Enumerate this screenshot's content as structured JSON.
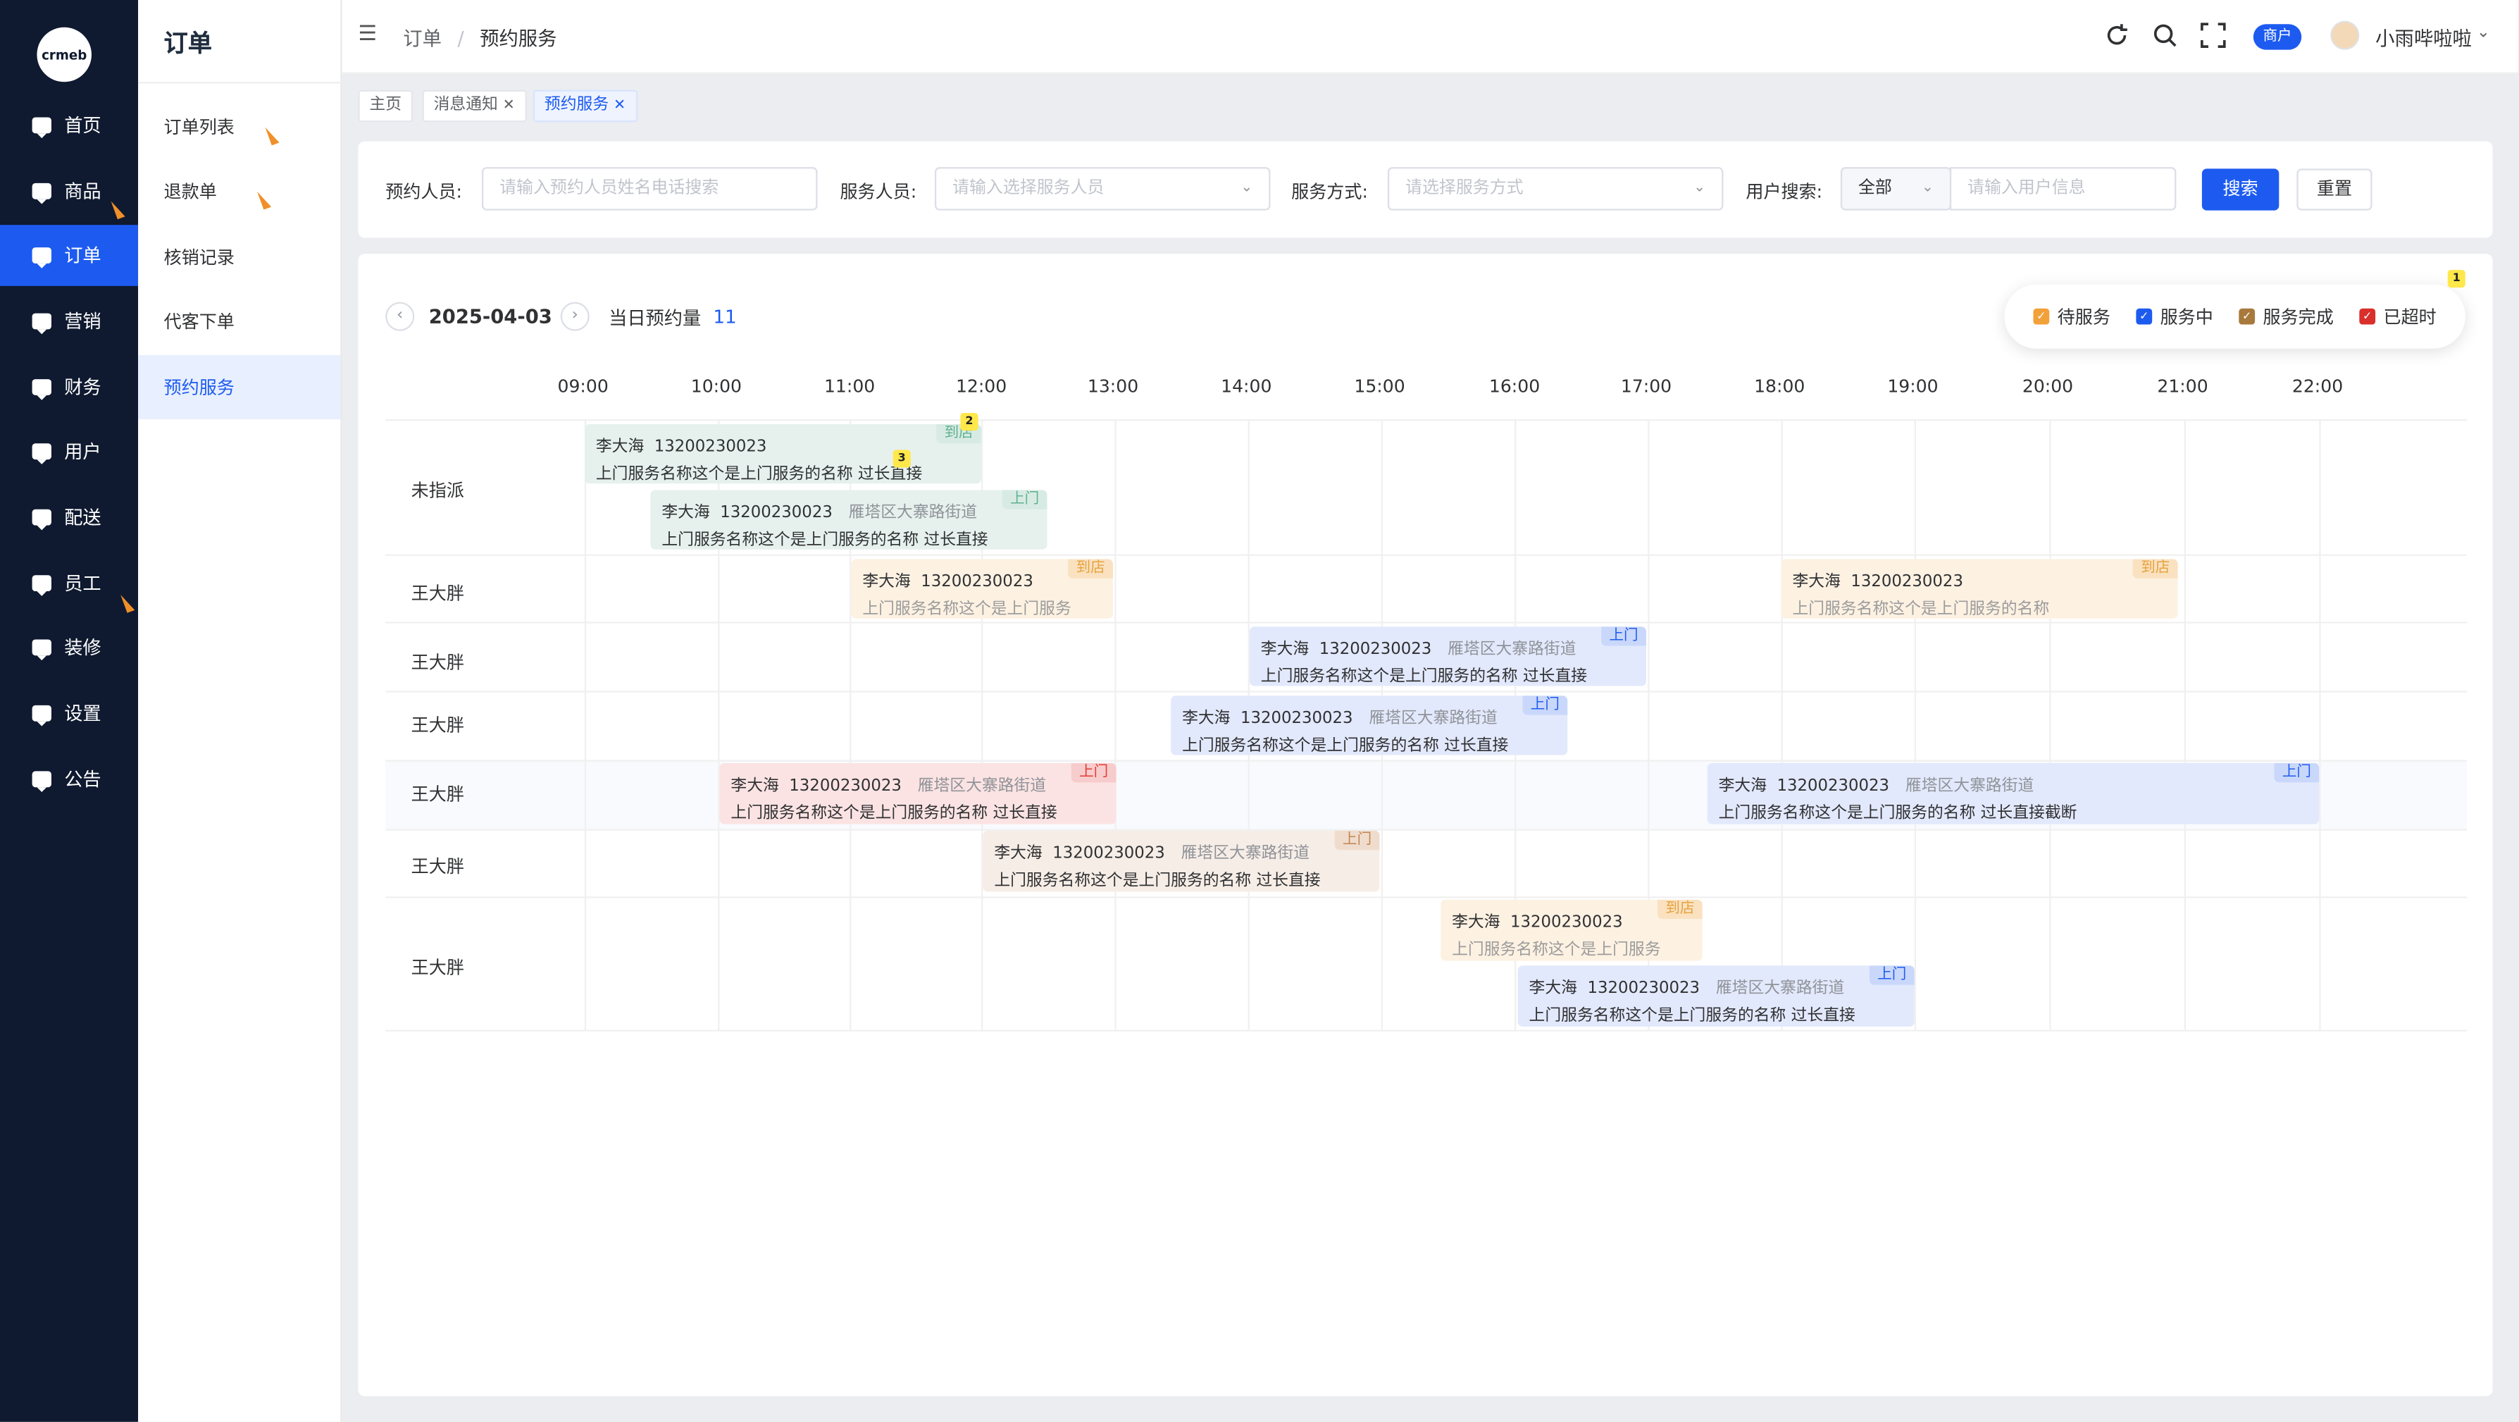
{
  "logo_text": "crmeb",
  "sidebar": {
    "items": [
      {
        "label": "首页"
      },
      {
        "label": "商品"
      },
      {
        "label": "订单"
      },
      {
        "label": "营销"
      },
      {
        "label": "财务"
      },
      {
        "label": "用户"
      },
      {
        "label": "配送"
      },
      {
        "label": "员工"
      },
      {
        "label": "装修"
      },
      {
        "label": "设置"
      },
      {
        "label": "公告"
      }
    ],
    "active": "订单"
  },
  "submenu": {
    "title": "订单",
    "items": [
      {
        "label": "订单列表"
      },
      {
        "label": "退款单"
      },
      {
        "label": "核销记录"
      },
      {
        "label": "代客下单"
      },
      {
        "label": "预约服务"
      }
    ],
    "active": "预约服务"
  },
  "topbar": {
    "breadcrumb": [
      "订单",
      "/",
      "预约服务"
    ],
    "merchant_badge": "商户",
    "username": "小雨哔啦啦",
    "icons": [
      "refresh-icon",
      "search-icon",
      "fullscreen-icon",
      "chevron-down-icon"
    ]
  },
  "tabs": [
    {
      "label": "主页",
      "closable": false
    },
    {
      "label": "消息通知",
      "closable": true
    },
    {
      "label": "预约服务",
      "closable": true,
      "active": true
    }
  ],
  "filter": {
    "booker_label": "预约人员:",
    "booker_placeholder": "请输入预约人员姓名电话搜索",
    "staff_label": "服务人员:",
    "staff_placeholder": "请输入选择服务人员",
    "method_label": "服务方式:",
    "method_placeholder": "请选择服务方式",
    "user_label": "用户搜索:",
    "user_type_value": "全部",
    "user_placeholder": "请输入用户信息",
    "search_button": "搜索",
    "reset_button": "重置"
  },
  "schedule": {
    "date": "2025-04-03",
    "count_label": "当日预约量",
    "count": "11",
    "legend": [
      {
        "label": "待服务",
        "color": "#f2a13a"
      },
      {
        "label": "服务中",
        "color": "#1d5bf0"
      },
      {
        "label": "服务完成",
        "color": "#a8793c"
      },
      {
        "label": "已超时",
        "color": "#d9302c"
      }
    ],
    "hours": [
      "09:00",
      "10:00",
      "11:00",
      "12:00",
      "13:00",
      "14:00",
      "15:00",
      "16:00",
      "17:00",
      "18:00",
      "19:00",
      "20:00",
      "21:00",
      "22:00"
    ],
    "rows": [
      {
        "staff": "未指派"
      },
      {
        "staff": "王大胖"
      },
      {
        "staff": "王大胖"
      },
      {
        "staff": "王大胖"
      },
      {
        "staff": "王大胖"
      },
      {
        "staff": "王大胖"
      },
      {
        "staff": "王大胖"
      }
    ],
    "bookings": [
      {
        "name": "李大海",
        "phone": "13200230023",
        "address": "",
        "desc": "上门服务名称这个是上门服务的名称 过长直接",
        "tag": "到店",
        "color": "green"
      },
      {
        "name": "李大海",
        "phone": "13200230023",
        "address": "雁塔区大寨路街道",
        "desc": "上门服务名称这个是上门服务的名称 过长直接",
        "tag": "上门",
        "color": "green"
      },
      {
        "name": "李大海",
        "phone": "13200230023",
        "address": "",
        "desc": "上门服务名称这个是上门服务",
        "tag": "到店",
        "color": "orange"
      },
      {
        "name": "李大海",
        "phone": "13200230023",
        "address": "",
        "desc": "上门服务名称这个是上门服务的名称",
        "tag": "到店",
        "color": "orange"
      },
      {
        "name": "李大海",
        "phone": "13200230023",
        "address": "雁塔区大寨路街道",
        "desc": "上门服务名称这个是上门服务的名称 过长直接",
        "tag": "上门",
        "color": "blue"
      },
      {
        "name": "李大海",
        "phone": "13200230023",
        "address": "雁塔区大寨路街道",
        "desc": "上门服务名称这个是上门服务的名称 过长直接",
        "tag": "上门",
        "color": "blue"
      },
      {
        "name": "李大海",
        "phone": "13200230023",
        "address": "雁塔区大寨路街道",
        "desc": "上门服务名称这个是上门服务的名称 过长直接",
        "tag": "上门",
        "color": "red"
      },
      {
        "name": "李大海",
        "phone": "13200230023",
        "address": "雁塔区大寨路街道",
        "desc": "上门服务名称这个是上门服务的名称 过长直接截断",
        "tag": "上门",
        "color": "blue"
      },
      {
        "name": "李大海",
        "phone": "13200230023",
        "address": "雁塔区大寨路街道",
        "desc": "上门服务名称这个是上门服务的名称 过长直接",
        "tag": "上门",
        "color": "tan"
      },
      {
        "name": "李大海",
        "phone": "13200230023",
        "address": "",
        "desc": "上门服务名称这个是上门服务",
        "tag": "到店",
        "color": "orange"
      },
      {
        "name": "李大海",
        "phone": "13200230023",
        "address": "雁塔区大寨路街道",
        "desc": "上门服务名称这个是上门服务的名称 过长直接",
        "tag": "上门",
        "color": "blue"
      }
    ],
    "markers": [
      "1",
      "2",
      "3"
    ]
  }
}
